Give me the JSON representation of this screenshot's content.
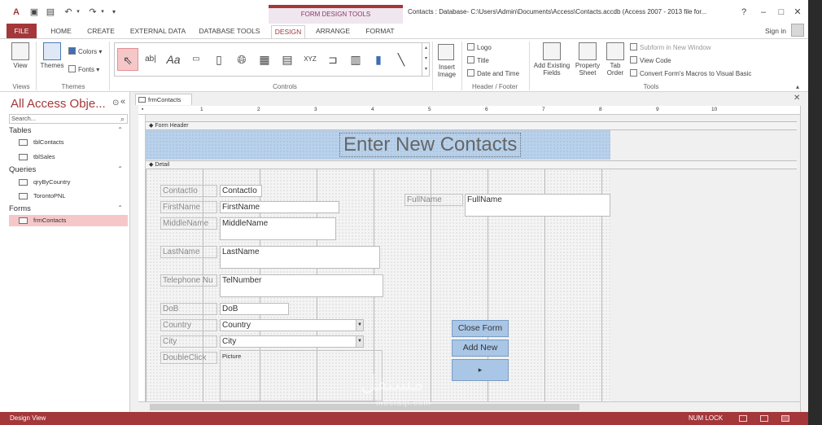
{
  "titlebar": {
    "context_label": "FORM DESIGN TOOLS",
    "window_title": "Contacts : Database- C:\\Users\\Admin\\Documents\\Access\\Contacts.accdb (Access 2007 - 2013 file for...",
    "help": "?",
    "minimize": "–",
    "restore": "□",
    "close": "✕"
  },
  "tabs": [
    "FILE",
    "HOME",
    "CREATE",
    "EXTERNAL DATA",
    "DATABASE TOOLS",
    "DESIGN",
    "ARRANGE",
    "FORMAT"
  ],
  "signin": "Sign in",
  "ribbon": {
    "views": {
      "view_label": "View",
      "group_label": "Views"
    },
    "themes": {
      "themes_label": "Themes",
      "colors_label": "Colors",
      "fonts_label": "Fonts",
      "group_label": "Themes"
    },
    "controls": {
      "group_label": "Controls",
      "label_glyph": "Aa",
      "textbox_glyph": "ab|",
      "xyz_glyph": "XYZ"
    },
    "insert_image": {
      "label_line1": "Insert",
      "label_line2": "Image"
    },
    "header_footer": {
      "logo": "Logo",
      "title": "Title",
      "date_time": "Date and Time",
      "group_label": "Header / Footer"
    },
    "tools": {
      "add_existing_line1": "Add Existing",
      "add_existing_line2": "Fields",
      "property_line1": "Property",
      "property_line2": "Sheet",
      "tab_order_line1": "Tab",
      "tab_order_line2": "Order",
      "subform": "Subform in New Window",
      "view_code": "View Code",
      "convert_macros": "Convert Form's Macros to Visual Basic",
      "group_label": "Tools"
    }
  },
  "nav": {
    "title": "All Access Obje...",
    "search_placeholder": "Search...",
    "sections": [
      {
        "label": "Tables",
        "items": [
          "tblContacts",
          "tblSales"
        ]
      },
      {
        "label": "Queries",
        "items": [
          "qryByCountry",
          "TorontoPNL"
        ]
      },
      {
        "label": "Forms",
        "items": [
          "frmContacts"
        ]
      }
    ]
  },
  "document": {
    "tab_label": "frmContacts",
    "ruler_numbers": [
      "1",
      "2",
      "3",
      "4",
      "5",
      "6",
      "7",
      "8",
      "9",
      "10"
    ],
    "form_header_label": "Form Header",
    "detail_label": "Detail",
    "form_title": "Enter New Contacts",
    "labels": {
      "contact_id": "ContactIo",
      "first_name": "FirstName",
      "middle_name": "MiddleName",
      "last_name": "LastName",
      "telephone": "Telephone Nu",
      "dob": "DoB",
      "country": "Country",
      "city": "City",
      "picture": "DoubleClick",
      "full_name": "FullName"
    },
    "fields": {
      "contact_id": "ContactIo",
      "first_name": "FirstName",
      "middle_name": "MiddleName",
      "last_name": "LastName",
      "telephone": "TelNumber",
      "dob": "DoB",
      "country": "Country",
      "city": "City",
      "picture": "Picture",
      "full_name": "FullName"
    },
    "buttons": {
      "close_form": "Close Form",
      "add_new": "Add New",
      "next": "▸"
    }
  },
  "statusbar": {
    "left": "Design View",
    "num_lock": "NUM LOCK"
  },
  "watermark": {
    "main": "مستقل",
    "sub": "mostaql.com"
  },
  "colors": {
    "accent": "#a4373a",
    "selection": "#f6c7c9",
    "header_band": "#b9d1ea",
    "button": "#a9c6e6"
  }
}
